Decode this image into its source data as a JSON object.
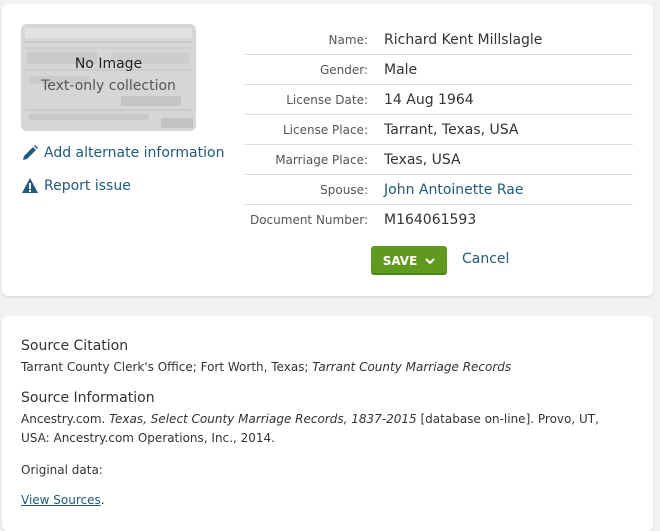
{
  "thumbnail": {
    "title": "No Image",
    "subtitle": "Text-only collection"
  },
  "actions": {
    "alternate": "Add alternate information",
    "report": "Report issue"
  },
  "fields": [
    {
      "label": "Name:",
      "value": "Richard Kent Millslagle",
      "link": false
    },
    {
      "label": "Gender:",
      "value": "Male",
      "link": false
    },
    {
      "label": "License Date:",
      "value": "14 Aug 1964",
      "link": false
    },
    {
      "label": "License Place:",
      "value": "Tarrant, Texas, USA",
      "link": false
    },
    {
      "label": "Marriage Place:",
      "value": "Texas, USA",
      "link": false
    },
    {
      "label": "Spouse:",
      "value": "John Antoinette Rae",
      "link": true
    },
    {
      "label": "Document Number:",
      "value": "M164061593",
      "link": false
    }
  ],
  "buttons": {
    "save": "SAVE",
    "cancel": "Cancel"
  },
  "source": {
    "citation_title": "Source Citation",
    "citation_text": "Tarrant County Clerk's Office; Fort Worth, Texas; ",
    "citation_italic": "Tarrant County Marriage Records",
    "info_title": "Source Information",
    "info_pre": "Ancestry.com. ",
    "info_italic": "Texas, Select County Marriage Records, 1837-2015",
    "info_post": " [database on-line]. Provo, UT, USA: Ancestry.com Operations, Inc., 2014.",
    "original_data": "Original data:",
    "view_sources": "View Sources",
    "view_sources_suffix": "."
  },
  "colors": {
    "link": "#215a7c",
    "save_green": "#5f9a1e"
  },
  "icons": {
    "alternate": "pencil-icon",
    "report": "warning-icon",
    "save_menu": "chevron-down-icon"
  }
}
